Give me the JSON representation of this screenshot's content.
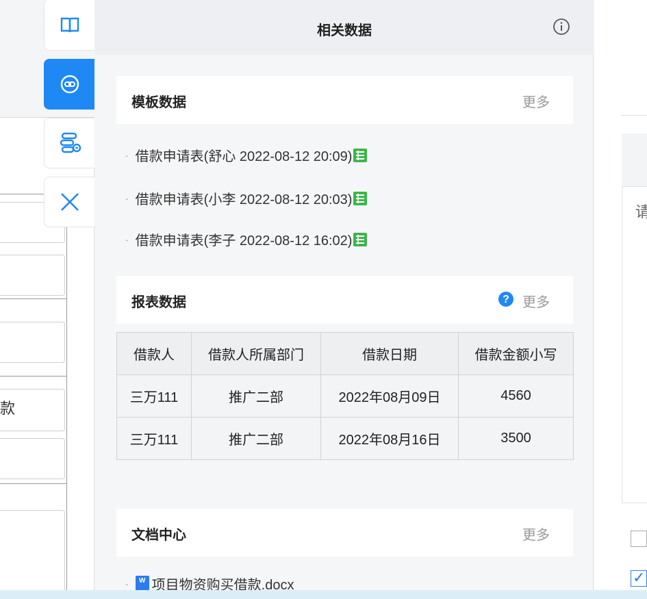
{
  "left_form": {
    "visible_field_text": "款"
  },
  "toolbar": {
    "buttons": [
      {
        "name": "book-icon"
      },
      {
        "name": "link-icon"
      },
      {
        "name": "link-settings-icon"
      },
      {
        "name": "close-icon"
      }
    ]
  },
  "panel": {
    "title": "相关数据",
    "template_section": {
      "title": "模板数据",
      "more": "更多",
      "items": [
        "借款申请表(舒心 2022-08-12 20:09)",
        "借款申请表(小李 2022-08-12 20:03)",
        "借款申请表(李子 2022-08-12 16:02)"
      ]
    },
    "report_section": {
      "title": "报表数据",
      "more": "更多",
      "columns": [
        "借款人",
        "借款人所属部门",
        "借款日期",
        "借款金额小写"
      ],
      "rows": [
        [
          "三万111",
          "推广二部",
          "2022年08月09日",
          "4560"
        ],
        [
          "三万111",
          "推广二部",
          "2022年08月16日",
          "3500"
        ]
      ]
    },
    "doc_section": {
      "title": "文档中心",
      "more": "更多",
      "items": [
        "项目物资购买借款.docx"
      ]
    }
  },
  "right_panel": {
    "partial_text": "请"
  },
  "colors": {
    "accent": "#1e88f5",
    "excel_green": "#3cb64a",
    "word_blue": "#2a7cf0"
  }
}
